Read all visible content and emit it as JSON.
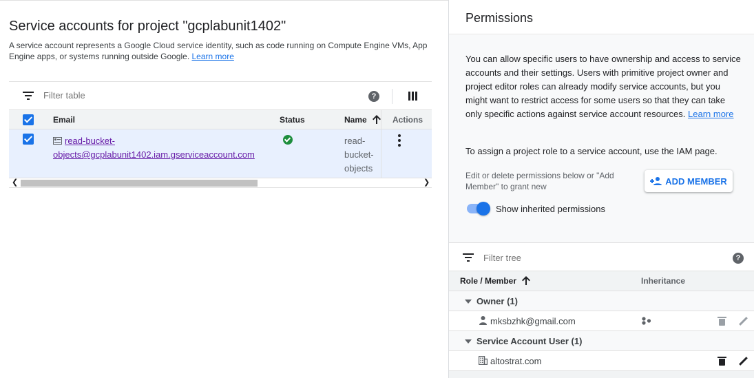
{
  "service_accounts": {
    "title": "Service accounts for project \"gcplabunit1402\"",
    "description": "A service account represents a Google Cloud service identity, such as code running on Compute Engine VMs, App Engine apps, or systems running outside Google.",
    "learn_more": "Learn more",
    "filter_placeholder": "Filter table",
    "columns": {
      "email": "Email",
      "status": "Status",
      "name": "Name",
      "actions": "Actions"
    },
    "rows": [
      {
        "email_line1": "read-bucket-",
        "email_line2": "objects@gcplabunit1402.iam.gserviceaccount.com",
        "status": "enabled",
        "name_line1": "read-",
        "name_line2": "bucket-",
        "name_line3": "objects",
        "selected": true
      }
    ]
  },
  "permissions": {
    "title": "Permissions",
    "intro": "You can allow specific users to have ownership and access to service accounts and their settings. Users with primitive project owner and project editor roles can already modify service accounts, but you might want to restrict access for some users so that they can take only specific actions against service account resources.",
    "learn_more": "Learn more",
    "assign_text": "To assign a project role to a service account, use the IAM page.",
    "edit_hint": "Edit or delete permissions below or \"Add Member\" to grant new",
    "add_member_label": "ADD MEMBER",
    "toggle_label": "Show inherited permissions",
    "toggle_on": true,
    "filter_placeholder": "Filter tree",
    "tree_columns": {
      "role": "Role / Member",
      "inheritance": "Inheritance"
    },
    "groups": [
      {
        "label": "Owner (1)",
        "member": "mksbzhk@gmail.com",
        "member_icon": "person-icon",
        "inherited": true
      },
      {
        "label": "Service Account User (1)",
        "member": "altostrat.com",
        "member_icon": "domain-icon",
        "inherited": false
      }
    ]
  },
  "colors": {
    "accent": "#1a73e8",
    "link_visited": "#681da8",
    "status_ok": "#1e8e3e",
    "selected_row": "#e8f0fe"
  }
}
